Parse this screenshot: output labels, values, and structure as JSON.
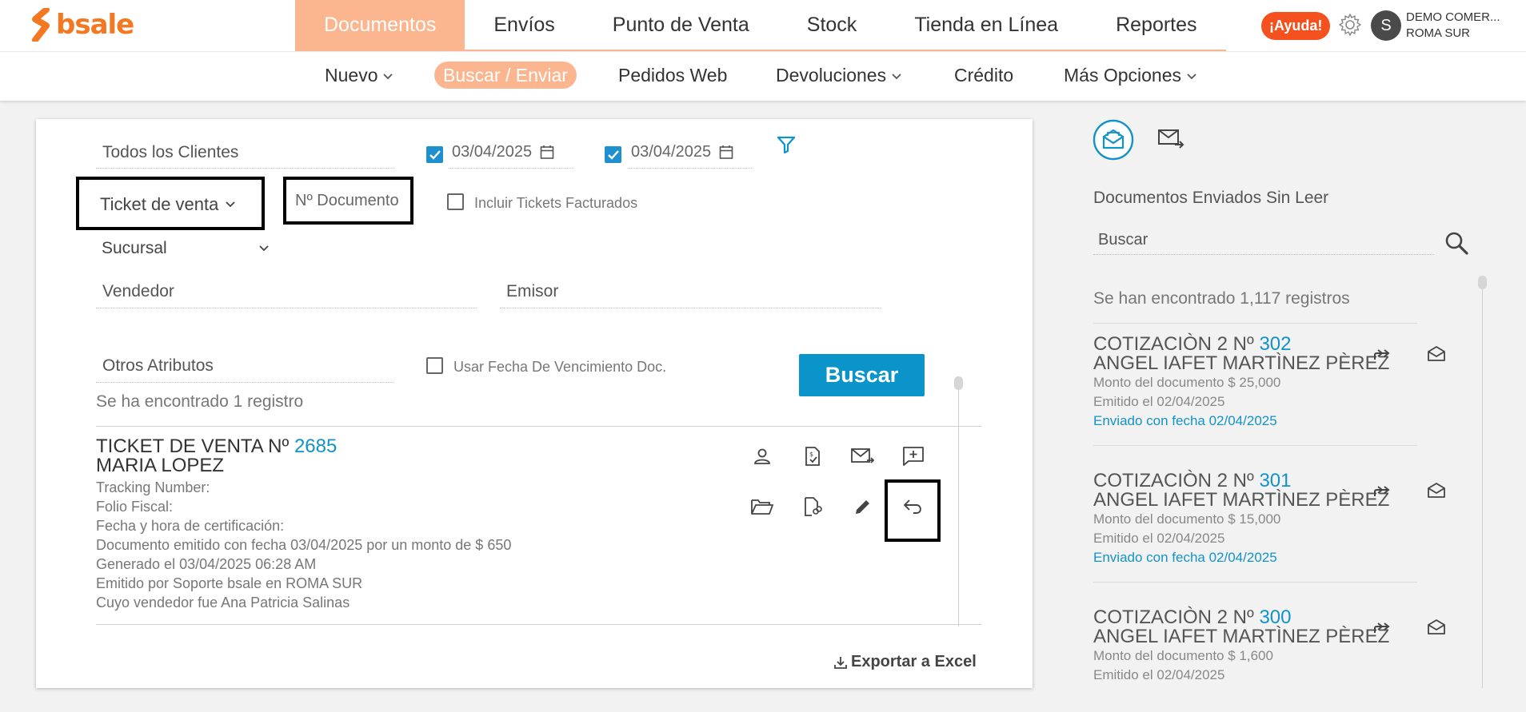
{
  "brand": {
    "name": "bsale",
    "color": "#f47721"
  },
  "main_nav": [
    {
      "label": "Documentos",
      "active": true
    },
    {
      "label": "Envíos"
    },
    {
      "label": "Punto de Venta"
    },
    {
      "label": "Stock"
    },
    {
      "label": "Tienda en Línea"
    },
    {
      "label": "Reportes"
    }
  ],
  "header": {
    "help_label": "¡Ayuda!",
    "avatar_initial": "S",
    "company": "DEMO COMER...",
    "branch": "ROMA SUR"
  },
  "sub_nav": [
    {
      "label": "Nuevo",
      "dropdown": true
    },
    {
      "label": "Buscar / Enviar",
      "active": true
    },
    {
      "label": "Pedidos Web"
    },
    {
      "label": "Devoluciones",
      "dropdown": true
    },
    {
      "label": "Crédito"
    },
    {
      "label": "Más Opciones",
      "dropdown": true
    }
  ],
  "filters": {
    "clients": "Todos los Clientes",
    "date_from": "03/04/2025",
    "date_to": "03/04/2025",
    "doc_type": "Ticket de venta",
    "doc_number_placeholder": "Nº Documento",
    "include_invoiced_label": "Incluir Tickets Facturados",
    "branch": "Sucursal",
    "seller": "Vendedor",
    "issuer": "Emisor",
    "other_attributes": "Otros Atributos",
    "use_due_date_label": "Usar Fecha De Vencimiento Doc.",
    "search_button": "Buscar"
  },
  "results": {
    "count_text": "Se ha encontrado 1 registro",
    "documents": [
      {
        "title": "TICKET DE VENTA Nº",
        "number": "2685",
        "client": "MARIA LOPEZ",
        "lines": [
          "Tracking Number:",
          "Folio Fiscal:",
          "Fecha y hora de certificación:",
          "Documento emitido con fecha 03/04/2025 por un monto de $ 650",
          "Generado el 03/04/2025 06:28 AM",
          "Emitido por Soporte bsale en ROMA SUR",
          "Cuyo vendedor fue Ana Patricia Salinas"
        ]
      }
    ],
    "export_label": "Exportar a Excel"
  },
  "right_panel": {
    "title": "Documentos Enviados Sin Leer",
    "search_placeholder": "Buscar",
    "count_text": "Se han encontrado 1,117 registros",
    "items": [
      {
        "title": "COTIZACIÒN 2 Nº",
        "number": "302",
        "client": "ANGEL IAFET MARTÌNEZ PÈREZ",
        "amount": "Monto del documento $ 25,000",
        "issued": "Emitido el 02/04/2025",
        "sent": "Enviado con fecha 02/04/2025"
      },
      {
        "title": "COTIZACIÒN 2 Nº",
        "number": "301",
        "client": "ANGEL IAFET MARTÌNEZ PÈREZ",
        "amount": "Monto del documento $ 15,000",
        "issued": "Emitido el 02/04/2025",
        "sent": "Enviado con fecha 02/04/2025"
      },
      {
        "title": "COTIZACIÒN 2 Nº",
        "number": "300",
        "client": "ANGEL IAFET MARTÌNEZ PÈREZ",
        "amount": "Monto del documento $ 1,600",
        "issued": "Emitido el 02/04/2025",
        "sent": ""
      }
    ]
  },
  "colors": {
    "accent_orange": "#fbb68f",
    "primary_blue": "#0a94c9",
    "link_blue": "#1293c8",
    "help_red": "#f4511e"
  }
}
